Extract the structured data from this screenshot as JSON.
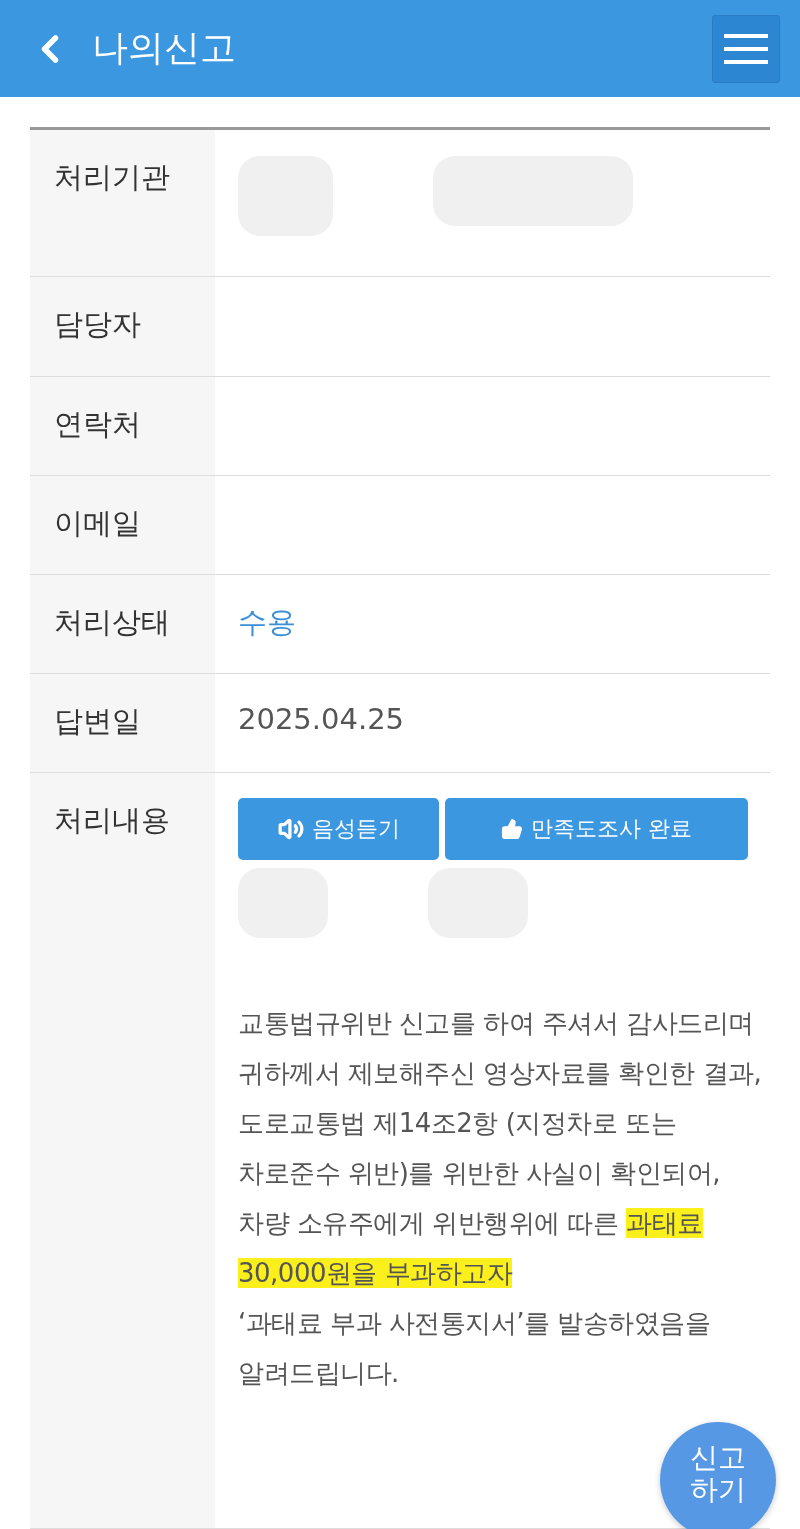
{
  "header": {
    "title": "나의신고"
  },
  "rows": [
    {
      "label": "처리기관",
      "kind": "redacted"
    },
    {
      "label": "담당자",
      "kind": "empty"
    },
    {
      "label": "연락처",
      "kind": "empty"
    },
    {
      "label": "이메일",
      "kind": "empty"
    },
    {
      "label": "처리상태",
      "kind": "status",
      "value": "수용"
    },
    {
      "label": "답변일",
      "kind": "text",
      "value": "2025.04.25"
    },
    {
      "label": "처리내용",
      "kind": "content"
    }
  ],
  "content": {
    "buttons": [
      {
        "label": "음성듣기",
        "kind": "audio"
      },
      {
        "label": "만족도조사 완료",
        "kind": "thumbs"
      }
    ],
    "lines": [
      [
        {
          "text": "교통법규위반 신고를 하여 주셔서 감사드리며 귀하께서 제보해주신 영상자료를 확인한 결과,",
          "highlighted": false
        }
      ],
      [
        {
          "text": "도로교통법 제14조2항 (지정차로 또는 차로준수 위반)를 위반한 사실이 확인되어,",
          "highlighted": false
        }
      ],
      [
        {
          "text": "차량 소유주에게 위반행위에 따른 ",
          "highlighted": false
        },
        {
          "text": "과태료 30,000원을 부과하고자",
          "highlighted": true
        }
      ],
      [
        {
          "text": "‘과태료 부과 사전통지서’를 발송하였음을 알려드립니다.",
          "highlighted": false
        }
      ]
    ]
  },
  "fab": {
    "lines": [
      "신고",
      "하기"
    ]
  }
}
